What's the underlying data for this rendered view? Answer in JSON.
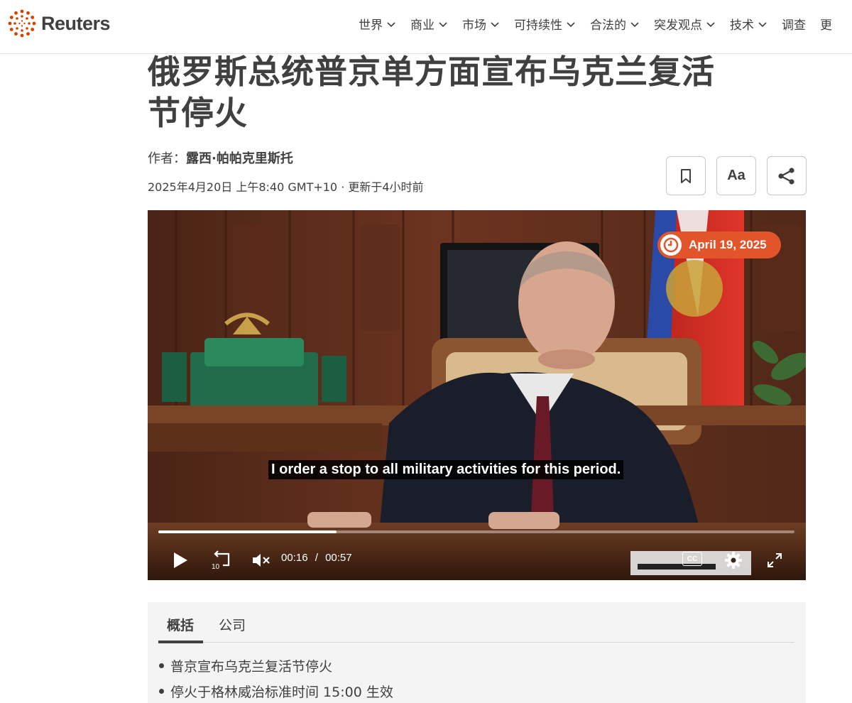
{
  "header": {
    "brand": "Reuters",
    "brand_color": "#d64000",
    "nav": [
      {
        "label": "世界",
        "has_dropdown": true
      },
      {
        "label": "商业",
        "has_dropdown": true
      },
      {
        "label": "市场",
        "has_dropdown": true
      },
      {
        "label": "可持续性",
        "has_dropdown": true
      },
      {
        "label": "合法的",
        "has_dropdown": true
      },
      {
        "label": "突发观点",
        "has_dropdown": true
      },
      {
        "label": "技术",
        "has_dropdown": true
      },
      {
        "label": "调查",
        "has_dropdown": false
      },
      {
        "label": "更",
        "has_dropdown": false
      }
    ]
  },
  "article": {
    "headline_line1": "俄罗斯总统普京单方面宣布乌克兰复活",
    "headline_line2": "节停火",
    "byline_prefix": "作者：",
    "author": "露西·帕帕克里斯托",
    "dateline": "2025年4月20日 上午8:40 GMT+10 · 更新于4小时前",
    "tools": {
      "bookmark_icon": "bookmark-icon",
      "text_size_label": "Aa",
      "share_icon": "share-icon"
    }
  },
  "video": {
    "date_badge": "April 19, 2025",
    "accent_color": "#e2552a",
    "caption": "I order a stop to all military activities for this period.",
    "current_time": "00:16",
    "time_separator": "/",
    "duration": "00:57",
    "progress_fraction": 0.28,
    "cc_label": "CC",
    "controls": [
      "play-icon",
      "replay-10-icon",
      "mute-icon",
      "cc-icon",
      "settings-icon",
      "fullscreen-icon"
    ],
    "replay_seconds": "10"
  },
  "summary": {
    "tabs": [
      {
        "label": "概括",
        "active": true
      },
      {
        "label": "公司",
        "active": false
      }
    ],
    "bullets": [
      "普京宣布乌克兰复活节停火",
      "停火于格林威治标准时间 15:00 生效"
    ]
  }
}
